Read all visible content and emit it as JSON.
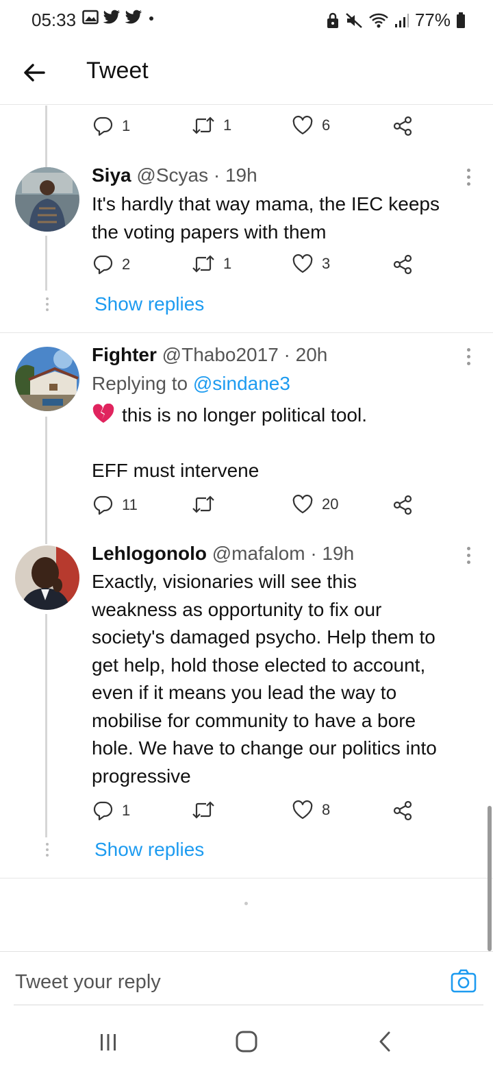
{
  "status_bar": {
    "time": "05:33",
    "battery": "77%"
  },
  "header": {
    "title": "Tweet"
  },
  "top_actions": {
    "replies": "1",
    "retweets": "1",
    "likes": "6"
  },
  "tweets": [
    {
      "display_name": "Siya",
      "meta": "@Scyas · 19h",
      "text_lines": [
        "It's hardly that way mama, the IEC keeps",
        "the voting papers with them"
      ],
      "replies": "2",
      "retweets": "1",
      "likes": "3",
      "show_replies": "Show replies"
    },
    {
      "display_name": "Fighter",
      "meta": "@Thabo2017 · 20h",
      "replying_prefix": "Replying to",
      "replying_handle": "@sindane3",
      "text_lines": [
        "this is no longer political tool.",
        "",
        "EFF must intervene"
      ],
      "replies": "11",
      "retweets": "",
      "likes": "20"
    },
    {
      "display_name": "Lehlogonolo",
      "meta": "@mafalom · 19h",
      "text_lines": [
        "Exactly, visionaries will see this",
        "weakness as opportunity to fix our",
        "society's damaged psycho. Help them to",
        "get help, hold those elected to account,",
        "even if it means you lead the way to",
        "mobilise for community to have a bore",
        "hole. We have to change our politics into",
        "progressive"
      ],
      "replies": "1",
      "retweets": "",
      "likes": "8",
      "show_replies": "Show replies"
    }
  ],
  "reply_box": {
    "placeholder": "Tweet your reply"
  },
  "icons": {
    "status": [
      "gallery-icon",
      "twitter-icon",
      "twitter-icon",
      "dot-icon",
      "lock-icon",
      "mute-icon",
      "wifi-icon",
      "signal-icon",
      "battery-icon"
    ],
    "actions": [
      "reply-icon",
      "retweet-icon",
      "like-icon",
      "share-icon"
    ],
    "nav": [
      "recent-apps-icon",
      "home-icon",
      "back-icon"
    ]
  },
  "colors": {
    "link": "#1d9bf0",
    "heart_emoji": "#e0245e"
  }
}
